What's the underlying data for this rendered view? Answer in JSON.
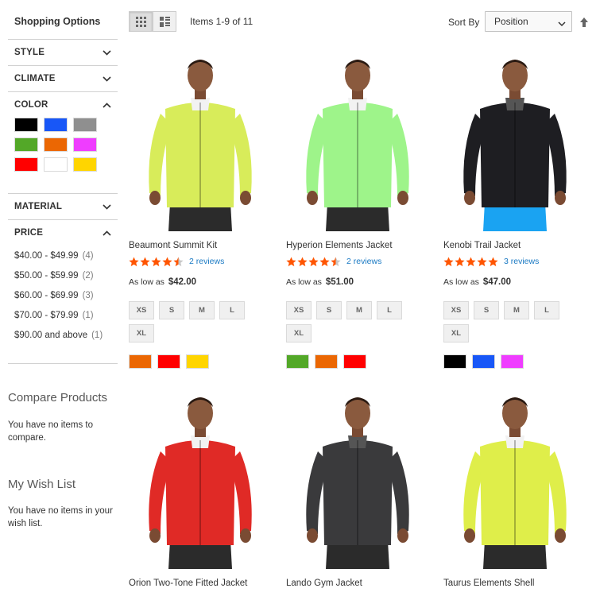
{
  "sidebar": {
    "title": "Shopping Options",
    "filters": {
      "style": "STYLE",
      "climate": "CLIMATE",
      "color": "COLOR",
      "material": "MATERIAL",
      "price": "PRICE"
    },
    "color_swatches": [
      {
        "name": "black",
        "hex": "#000000"
      },
      {
        "name": "blue",
        "hex": "#1857f7"
      },
      {
        "name": "gray",
        "hex": "#8f8f8f"
      },
      {
        "name": "green",
        "hex": "#53a828"
      },
      {
        "name": "orange",
        "hex": "#eb6703"
      },
      {
        "name": "purple",
        "hex": "#ef3dff"
      },
      {
        "name": "red",
        "hex": "#ff0000"
      },
      {
        "name": "white",
        "hex": "#ffffff"
      },
      {
        "name": "yellow",
        "hex": "#ffd500"
      }
    ],
    "price_ranges": [
      {
        "label": "$40.00 - $49.99",
        "count": "(4)"
      },
      {
        "label": "$50.00 - $59.99",
        "count": "(2)"
      },
      {
        "label": "$60.00 - $69.99",
        "count": "(3)"
      },
      {
        "label": "$70.00 - $79.99",
        "count": "(1)"
      },
      {
        "label": "$90.00 and above",
        "count": "(1)"
      }
    ],
    "compare": {
      "title": "Compare Products",
      "text": "You have no items to compare."
    },
    "wishlist": {
      "title": "My Wish List",
      "text": "You have no items in your wish list."
    }
  },
  "toolbar": {
    "amount": "Items 1-9 of 11",
    "sort_label": "Sort By",
    "sort_value": "Position",
    "view_modes": [
      "grid-icon",
      "list-icon"
    ]
  },
  "products": [
    {
      "name": "Beaumont Summit Kit",
      "rating": 0.9,
      "reviews": "2 reviews",
      "price_prefix": "As low as",
      "price": "$42.00",
      "sizes": [
        "XS",
        "S",
        "M",
        "L",
        "XL"
      ],
      "colors": [
        "#eb6703",
        "#ff0000",
        "#ffd500"
      ],
      "jacket_color": "#d8ec5a"
    },
    {
      "name": "Hyperion Elements Jacket",
      "rating": 0.9,
      "reviews": "2 reviews",
      "price_prefix": "As low as",
      "price": "$51.00",
      "sizes": [
        "XS",
        "S",
        "M",
        "L",
        "XL"
      ],
      "colors": [
        "#53a828",
        "#eb6703",
        "#ff0000"
      ],
      "jacket_color": "#9ef48a"
    },
    {
      "name": "Kenobi Trail Jacket",
      "rating": 1.0,
      "reviews": "3 reviews",
      "price_prefix": "As low as",
      "price": "$47.00",
      "sizes": [
        "XS",
        "S",
        "M",
        "L",
        "XL"
      ],
      "colors": [
        "#000000",
        "#1857f7",
        "#ef3dff"
      ],
      "jacket_color": "#1e1e22"
    },
    {
      "name": "Orion Two-Tone Fitted Jacket",
      "jacket_color": "#e02a26"
    },
    {
      "name": "Lando Gym Jacket",
      "jacket_color": "#3a3a3c"
    },
    {
      "name": "Taurus Elements Shell",
      "jacket_color": "#dfee4a"
    }
  ],
  "colors": {
    "star": "#ff5501",
    "link": "#1979c3"
  }
}
